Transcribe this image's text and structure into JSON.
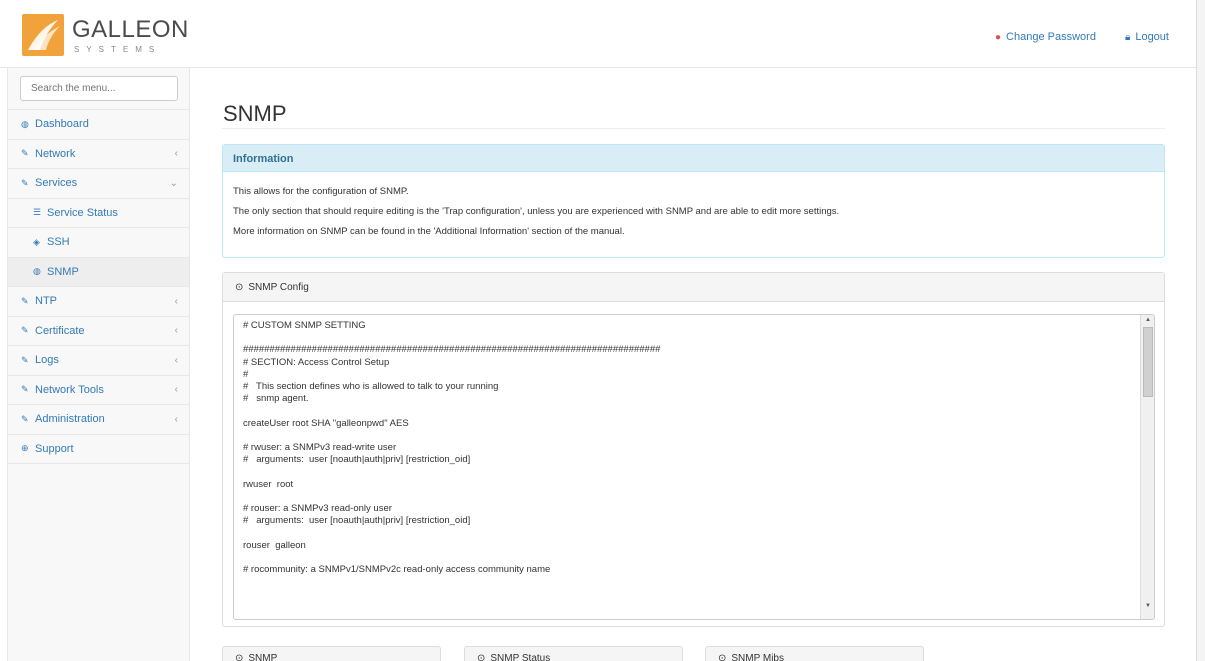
{
  "header": {
    "logo_text": "GALLEON",
    "logo_subtext": "SYSTEMS",
    "change_password_label": "Change Password",
    "logout_label": "Logout"
  },
  "sidebar": {
    "search_placeholder": "Search the menu...",
    "items": [
      {
        "label": "Dashboard",
        "icon": "dashboard-icon"
      },
      {
        "label": "Network",
        "icon": "wrench-icon",
        "arrow": "‹"
      },
      {
        "label": "Services",
        "icon": "wrench-icon",
        "arrow": "⌄"
      },
      {
        "label": "Service Status",
        "icon": "list-icon"
      },
      {
        "label": "SSH",
        "icon": "cube-icon"
      },
      {
        "label": "SNMP",
        "icon": "dashboard-icon"
      },
      {
        "label": "NTP",
        "icon": "wrench-icon",
        "arrow": "‹"
      },
      {
        "label": "Certificate",
        "icon": "wrench-icon",
        "arrow": "‹"
      },
      {
        "label": "Logs",
        "icon": "wrench-icon",
        "arrow": "‹"
      },
      {
        "label": "Network Tools",
        "icon": "wrench-icon",
        "arrow": "‹"
      },
      {
        "label": "Administration",
        "icon": "wrench-icon",
        "arrow": "‹"
      },
      {
        "label": "Support",
        "icon": "lifebuoy-icon"
      }
    ]
  },
  "main": {
    "title": "SNMP",
    "info": {
      "heading": "Information",
      "lines": [
        "This allows for the configuration of SNMP.",
        "The only section that should require editing is the 'Trap configuration', unless you are experienced with SNMP and are able to edit more settings.",
        "More information on SNMP can be found in the 'Additional Information' section of the manual."
      ]
    },
    "config": {
      "heading": "SNMP Config",
      "text": "# CUSTOM SNMP SETTING\n\n###############################################################################\n# SECTION: Access Control Setup\n#\n#   This section defines who is allowed to talk to your running\n#   snmp agent.\n\ncreateUser root SHA \"galleonpwd\" AES\n\n# rwuser: a SNMPv3 read-write user\n#   arguments:  user [noauth|auth|priv] [restriction_oid]\n\nrwuser  root\n\n# rouser: a SNMPv3 read-only user\n#   arguments:  user [noauth|auth|priv] [restriction_oid]\n\nrouser  galleon\n\n# rocommunity: a SNMPv1/SNMPv2c read-only access community name"
    },
    "bottom_tabs": [
      "SNMP",
      "SNMP Status",
      "SNMP Mibs"
    ]
  }
}
